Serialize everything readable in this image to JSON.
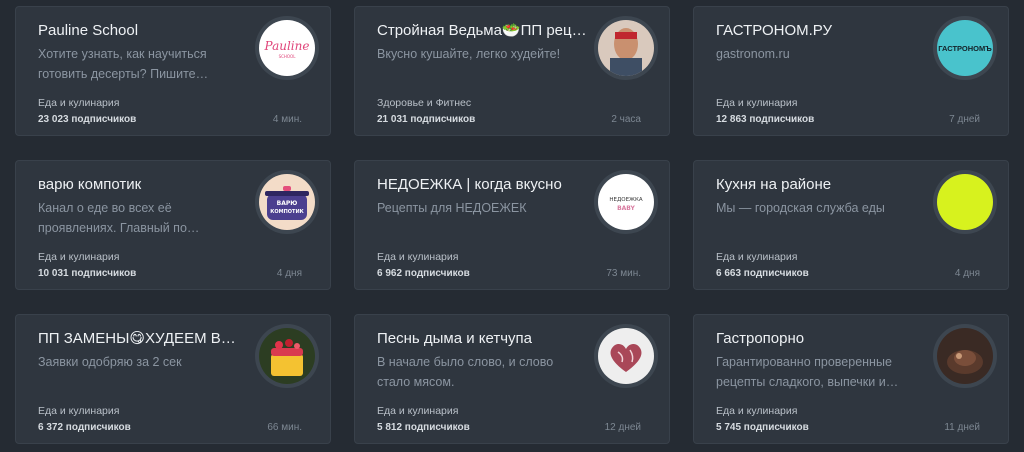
{
  "channels": [
    {
      "title": "Pauline School",
      "description": "Хотите узнать, как научиться готовить десерты? Пишите…",
      "category": "Еда и кулинария",
      "subscribers": "23 023 подписчиков",
      "time": "4 мин.",
      "avatar_icon": "pauline-school-logo",
      "avatar_lines": [
        "Pauline",
        "SCHOOL"
      ]
    },
    {
      "title": "Стройная Ведьма🥗ПП рец…",
      "description": "Вкусно кушайте, легко худейте!",
      "category": "Здоровье и Фитнес",
      "subscribers": "21 031 подписчиков",
      "time": "2 часа",
      "avatar_icon": "fitness-photo-avatar",
      "avatar_lines": []
    },
    {
      "title": "ГАСТРОНОМ.РУ",
      "description": "gastronom.ru",
      "category": "Еда и кулинария",
      "subscribers": "12 863 подписчиков",
      "time": "7 дней",
      "avatar_icon": "gastronom-logo",
      "avatar_lines": [
        "ГАСТРОНОМЪ"
      ]
    },
    {
      "title": "варю компотик",
      "description": "Канал о еде во всех её проявлениях. Главный по…",
      "category": "Еда и кулинария",
      "subscribers": "10 031 подписчиков",
      "time": "4 дня",
      "avatar_icon": "pot-logo",
      "avatar_lines": [
        "ВАРЮ",
        "КОМПОТИК"
      ]
    },
    {
      "title": "НЕДОЕЖКА | когда вкусно",
      "description": "Рецепты для НЕДОЕЖЕК",
      "category": "Еда и кулинария",
      "subscribers": "6 962 подписчиков",
      "time": "73 мин.",
      "avatar_icon": "nedoezhka-logo",
      "avatar_lines": [
        "НЕДОЕЖКА",
        "BABY"
      ]
    },
    {
      "title": "Кухня на районе",
      "description": "Мы — городская служба еды",
      "category": "Еда и кулинария",
      "subscribers": "6 663 подписчиков",
      "time": "4 дня",
      "avatar_icon": "lime-circle-avatar",
      "avatar_lines": []
    },
    {
      "title": "ПП ЗАМЕНЫ😋ХУДЕЕМ В…",
      "description": "Заявки одобряю за 2 сек",
      "category": "Еда и кулинария",
      "subscribers": "6 372 подписчиков",
      "time": "66 мин.",
      "avatar_icon": "dessert-photo-avatar",
      "avatar_lines": []
    },
    {
      "title": "Песнь дыма и кетчупа",
      "description": "В начале было слово, и слово стало мясом.",
      "category": "Еда и кулинария",
      "subscribers": "5 812 подписчиков",
      "time": "12 дней",
      "avatar_icon": "meat-heart-avatar",
      "avatar_lines": []
    },
    {
      "title": "Гастропорно",
      "description": "Гарантированно проверенные рецепты сладкого, выпечки и…",
      "category": "Еда и кулинария",
      "subscribers": "5 745 подписчиков",
      "time": "11 дней",
      "avatar_icon": "food-photo-avatar",
      "avatar_lines": []
    }
  ]
}
